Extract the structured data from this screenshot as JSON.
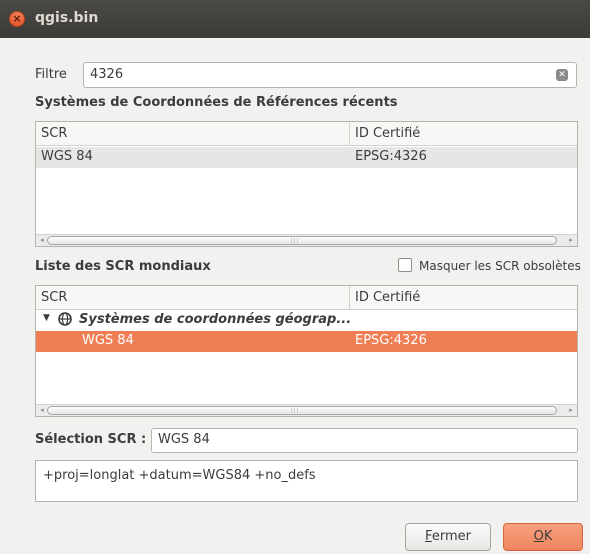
{
  "window": {
    "title": "qgis.bin",
    "close_glyph": "×"
  },
  "filter": {
    "label": "Filtre",
    "value": "4326",
    "clear_glyph": "✕"
  },
  "recent": {
    "title": "Systèmes de Coordonnées de Références récents",
    "columns": [
      "SCR",
      "ID Certifié"
    ],
    "rows": [
      {
        "crs": "WGS 84",
        "id": "EPSG:4326"
      }
    ]
  },
  "world": {
    "title": "Liste des SCR mondiaux",
    "hide_obsolete_label": "Masquer les SCR obsolètes",
    "hide_obsolete_checked": false,
    "columns": [
      "SCR",
      "ID Certifié"
    ],
    "group": {
      "expander": "▼",
      "label": "Systèmes de coordonnées géograp..."
    },
    "rows": [
      {
        "crs": "WGS 84",
        "id": "EPSG:4326",
        "selected": true
      }
    ]
  },
  "selection": {
    "label": "Sélection SCR :",
    "value": "WGS 84"
  },
  "proj_string": "+proj=longlat +datum=WGS84 +no_defs",
  "buttons": {
    "close": {
      "mnemonic": "F",
      "rest": "ermer"
    },
    "ok": {
      "mnemonic": "O",
      "rest": "K"
    }
  },
  "scroll": {
    "left_arrow": "◂",
    "right_arrow": "▸",
    "grip": "|||"
  },
  "colors": {
    "accent": "#ef7e54",
    "titlebar": "#3c3b37"
  }
}
